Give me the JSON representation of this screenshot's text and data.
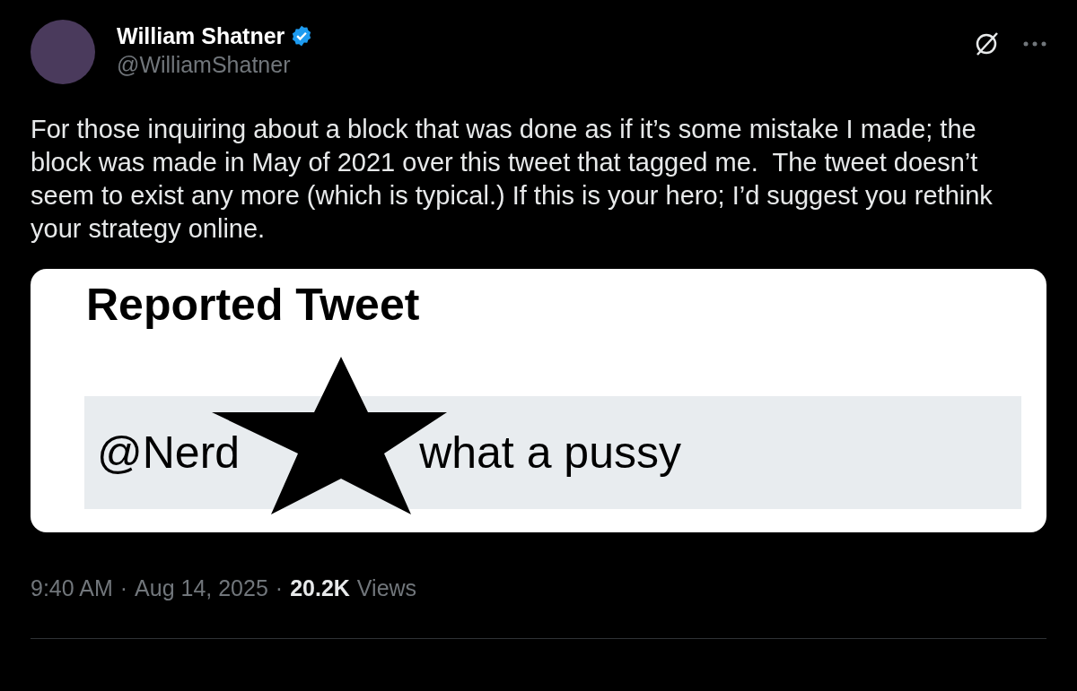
{
  "author": {
    "name": "William Shatner",
    "handle": "@WilliamShatner",
    "verified": true
  },
  "text": "For those inquiring about a block that was done as if it’s some mistake I made; the block was made in May of 2021 over this tweet that tagged me.  The tweet doesn’t seem to exist any more (which is typical.) If this is your hero; I’d suggest you rethink your strategy online.",
  "attachment": {
    "title": "Reported Tweet",
    "mention": "@Nerd",
    "message": "what a pussy"
  },
  "meta": {
    "time": "9:40 AM",
    "date": "Aug 14, 2025",
    "views_count": "20.2K",
    "views_label": "Views",
    "separator": "·"
  }
}
